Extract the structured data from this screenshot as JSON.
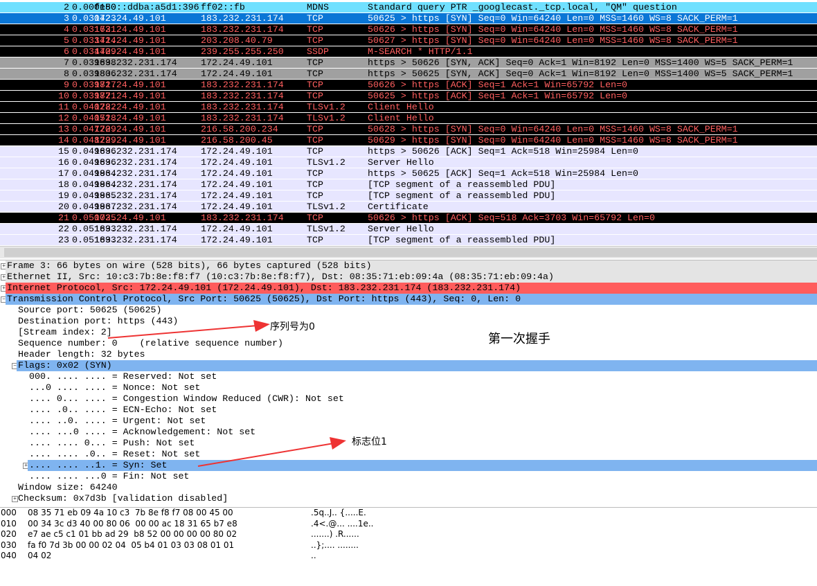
{
  "colors": {
    "selected": "#0a76d6",
    "bad_bg": "#000000",
    "bad_fg": "#ff5f5f",
    "mdns": "#70e0ff",
    "gray": "#a0a0a0",
    "lavender": "#e7e6ff",
    "ip_row": "#ff5c5c",
    "tcp_row": "#7fb4f0",
    "arrow": "#ee3333"
  },
  "packets": [
    {
      "no": "2",
      "time": "0.000150",
      "src": "fe80::ddba:a5d1:396",
      "dst": "ff02::fb",
      "proto": "MDNS",
      "info": "Standard query PTR _googlecast._tcp.local, \"QM\" question",
      "style": "mdns"
    },
    {
      "no": "3",
      "time": "0.030423",
      "src": "172.24.49.101",
      "dst": "183.232.231.174",
      "proto": "TCP",
      "info": "50625 > https [SYN] Seq=0 Win=64240 Len=0 MSS=1460 WS=8 SACK_PERM=1",
      "style": "sel"
    },
    {
      "no": "4",
      "time": "0.031631",
      "src": "172.24.49.101",
      "dst": "183.232.231.174",
      "proto": "TCP",
      "info": "50626 > https [SYN] Seq=0 Win=64240 Len=0 MSS=1460 WS=8 SACK_PERM=1",
      "style": "bad"
    },
    {
      "no": "5",
      "time": "0.033414",
      "src": "172.24.49.101",
      "dst": "203.208.40.79",
      "proto": "TCP",
      "info": "50627 > https [SYN] Seq=0 Win=64240 Len=0 MSS=1460 WS=8 SACK_PERM=1",
      "style": "bad"
    },
    {
      "no": "6",
      "time": "0.034409",
      "src": "172.24.49.101",
      "dst": "239.255.255.250",
      "proto": "SSDP",
      "info": "M-SEARCH * HTTP/1.1",
      "style": "bad"
    },
    {
      "no": "7",
      "time": "0.039698",
      "src": "183.232.231.174",
      "dst": "172.24.49.101",
      "proto": "TCP",
      "info": "https > 50626 [SYN, ACK] Seq=0 Ack=1 Win=8192 Len=0 MSS=1400 WS=5 SACK_PERM=1",
      "style": "gray"
    },
    {
      "no": "8",
      "time": "0.039806",
      "src": "183.232.231.174",
      "dst": "172.24.49.101",
      "proto": "TCP",
      "info": "https > 50625 [SYN, ACK] Seq=0 Ack=1 Win=8192 Len=0 MSS=1400 WS=5 SACK_PERM=1",
      "style": "gray"
    },
    {
      "no": "9",
      "time": "0.039817",
      "src": "172.24.49.101",
      "dst": "183.232.231.174",
      "proto": "TCP",
      "info": "50626 > https [ACK] Seq=1 Ack=1 Win=65792 Len=0",
      "style": "bad"
    },
    {
      "no": "10",
      "time": "0.039871",
      "src": "172.24.49.101",
      "dst": "183.232.231.174",
      "proto": "TCP",
      "info": "50625 > https [ACK] Seq=1 Ack=1 Win=65792 Len=0",
      "style": "bad"
    },
    {
      "no": "11",
      "time": "0.040282",
      "src": "172.24.49.101",
      "dst": "183.232.231.174",
      "proto": "TLSv1.2",
      "info": "Client Hello",
      "style": "bad"
    },
    {
      "no": "12",
      "time": "0.040518",
      "src": "172.24.49.101",
      "dst": "183.232.231.174",
      "proto": "TLSv1.2",
      "info": "Client Hello",
      "style": "bad"
    },
    {
      "no": "13",
      "time": "0.047209",
      "src": "172.24.49.101",
      "dst": "216.58.200.234",
      "proto": "TCP",
      "info": "50628 > https [SYN] Seq=0 Win=64240 Len=0 MSS=1460 WS=8 SACK_PERM=1",
      "style": "bad"
    },
    {
      "no": "14",
      "time": "0.048299",
      "src": "172.24.49.101",
      "dst": "216.58.200.45",
      "proto": "TCP",
      "info": "50629 > https [SYN] Seq=0 Win=64240 Len=0 MSS=1460 WS=8 SACK_PERM=1",
      "style": "bad"
    },
    {
      "no": "15",
      "time": "0.049696",
      "src": "183.232.231.174",
      "dst": "172.24.49.101",
      "proto": "TCP",
      "info": "https > 50626 [ACK] Seq=1 Ack=518 Win=25984 Len=0",
      "style": "lav"
    },
    {
      "no": "16",
      "time": "0.049696",
      "src": "183.232.231.174",
      "dst": "172.24.49.101",
      "proto": "TLSv1.2",
      "info": "Server Hello",
      "style": "lav"
    },
    {
      "no": "17",
      "time": "0.049964",
      "src": "183.232.231.174",
      "dst": "172.24.49.101",
      "proto": "TCP",
      "info": "https > 50625 [ACK] Seq=1 Ack=518 Win=25984 Len=0",
      "style": "lav"
    },
    {
      "no": "18",
      "time": "0.049964",
      "src": "183.232.231.174",
      "dst": "172.24.49.101",
      "proto": "TCP",
      "info": "[TCP segment of a reassembled PDU]",
      "style": "lav"
    },
    {
      "no": "19",
      "time": "0.049965",
      "src": "183.232.231.174",
      "dst": "172.24.49.101",
      "proto": "TCP",
      "info": "[TCP segment of a reassembled PDU]",
      "style": "lav"
    },
    {
      "no": "20",
      "time": "0.049967",
      "src": "183.232.231.174",
      "dst": "172.24.49.101",
      "proto": "TLSv1.2",
      "info": "Certificate",
      "style": "lav"
    },
    {
      "no": "21",
      "time": "0.050035",
      "src": "172.24.49.101",
      "dst": "183.232.231.174",
      "proto": "TCP",
      "info": "50626 > https [ACK] Seq=518 Ack=3703 Win=65792 Len=0",
      "style": "bad"
    },
    {
      "no": "22",
      "time": "0.051693",
      "src": "183.232.231.174",
      "dst": "172.24.49.101",
      "proto": "TLSv1.2",
      "info": "Server Hello",
      "style": "lav"
    },
    {
      "no": "23",
      "time": "0.051693",
      "src": "183.232.231.174",
      "dst": "172.24.49.101",
      "proto": "TCP",
      "info": "[TCP segment of a reassembled PDU]",
      "style": "lav"
    }
  ],
  "details": [
    {
      "text": "Frame 3: 66 bytes on wire (528 bits), 66 bytes captured (528 bits)",
      "level": 0,
      "exp": "+",
      "hl": "gray"
    },
    {
      "text": "Ethernet II, Src: 10:c3:7b:8e:f8:f7 (10:c3:7b:8e:f8:f7), Dst: 08:35:71:eb:09:4a (08:35:71:eb:09:4a)",
      "level": 0,
      "exp": "+",
      "hl": "gray"
    },
    {
      "text": "Internet Protocol, Src: 172.24.49.101 (172.24.49.101), Dst: 183.232.231.174 (183.232.231.174)",
      "level": 0,
      "exp": "+",
      "hl": "red"
    },
    {
      "text": "Transmission Control Protocol, Src Port: 50625 (50625), Dst Port: https (443), Seq: 0, Len: 0",
      "level": 0,
      "exp": "-",
      "hl": "blue"
    },
    {
      "text": "Source port: 50625 (50625)",
      "level": 1
    },
    {
      "text": "Destination port: https (443)",
      "level": 1
    },
    {
      "text": "[Stream index: 2]",
      "level": 1
    },
    {
      "text": "Sequence number: 0    (relative sequence number)",
      "level": 1
    },
    {
      "text": "Header length: 32 bytes",
      "level": 1
    },
    {
      "text": "Flags: 0x02 (SYN)",
      "level": 1,
      "exp": "-",
      "hl": "blue"
    },
    {
      "text": "000. .... .... = Reserved: Not set",
      "level": 2
    },
    {
      "text": "...0 .... .... = Nonce: Not set",
      "level": 2
    },
    {
      "text": ".... 0... .... = Congestion Window Reduced (CWR): Not set",
      "level": 2
    },
    {
      "text": ".... .0.. .... = ECN-Echo: Not set",
      "level": 2
    },
    {
      "text": ".... ..0. .... = Urgent: Not set",
      "level": 2
    },
    {
      "text": ".... ...0 .... = Acknowledgement: Not set",
      "level": 2
    },
    {
      "text": ".... .... 0... = Push: Not set",
      "level": 2
    },
    {
      "text": ".... .... .0.. = Reset: Not set",
      "level": 2
    },
    {
      "text": ".... .... ..1. = Syn: Set",
      "level": 2,
      "exp": "+",
      "hl": "blue"
    },
    {
      "text": ".... .... ...0 = Fin: Not set",
      "level": 2
    },
    {
      "text": "Window size: 64240",
      "level": 1
    },
    {
      "text": "Checksum: 0x7d3b [validation disabled]",
      "level": 1,
      "exp": "+"
    }
  ],
  "hex": [
    {
      "off": "000",
      "bytes": "08 35 71 eb 09 4a 10 c3  7b 8e f8 f7 08 00 45 00",
      "ascii": ".5q..J.. {.....E."
    },
    {
      "off": "010",
      "bytes": "00 34 3c d3 40 00 80 06  00 00 ac 18 31 65 b7 e8",
      "ascii": ".4<.@... ....1e.."
    },
    {
      "off": "020",
      "bytes": "e7 ae c5 c1 01 bb ad 29  b8 52 00 00 00 00 80 02",
      "ascii": ".......) .R......"
    },
    {
      "off": "030",
      "bytes": "fa f0 7d 3b 00 00 02 04  05 b4 01 03 03 08 01 01",
      "ascii": "..};.... ........"
    },
    {
      "off": "040",
      "bytes": "04 02",
      "ascii": ".."
    }
  ],
  "annotations": {
    "seq_note": "序列号为0",
    "flag_note": "标志位1",
    "handshake_title": "第一次握手"
  }
}
